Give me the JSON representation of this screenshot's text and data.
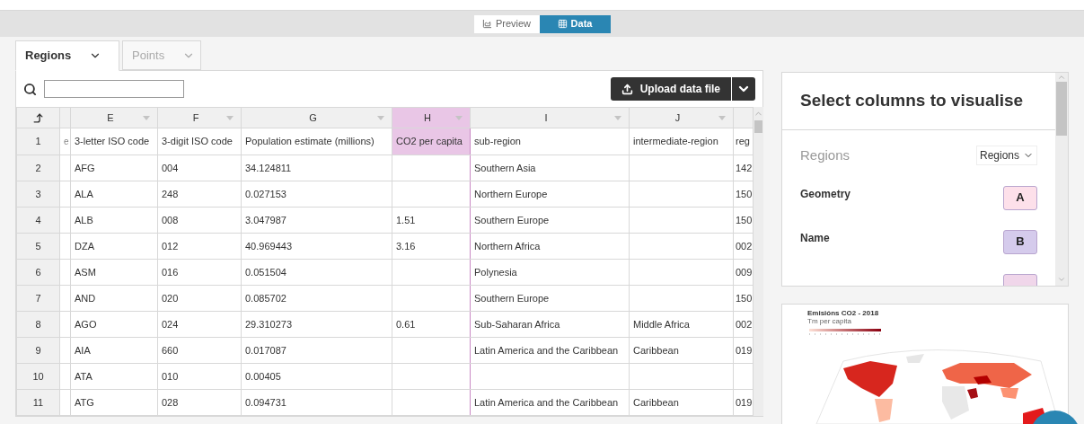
{
  "view_toggle": [
    {
      "label": "Preview",
      "kind": "chart",
      "selected": false
    },
    {
      "label": "Data",
      "kind": "table",
      "selected": true
    }
  ],
  "sheet_tabs": [
    {
      "label": "Regions",
      "selected": true
    },
    {
      "label": "Points",
      "selected": false
    }
  ],
  "upload_button": {
    "label": "Upload data file"
  },
  "table": {
    "columns": [
      {
        "header": "e",
        "highlighted": false
      },
      {
        "letter": "E",
        "header": "3-letter ISO code",
        "highlighted": false
      },
      {
        "letter": "F",
        "header": "3-digit ISO code",
        "highlighted": false
      },
      {
        "letter": "G",
        "header": "Population estimate (millions)",
        "highlighted": false
      },
      {
        "letter": "H",
        "header": "CO2 per capita",
        "highlighted": true
      },
      {
        "letter": "I",
        "header": "sub-region",
        "highlighted": false
      },
      {
        "letter": "J",
        "header": "intermediate-region",
        "highlighted": false
      },
      {
        "header": "reg",
        "highlighted": false
      }
    ],
    "header_row_number": "1",
    "rows": [
      {
        "number": "2",
        "cells": [
          "",
          "AFG",
          "004",
          "34.124811",
          "",
          "Southern Asia",
          "",
          "142"
        ]
      },
      {
        "number": "3",
        "cells": [
          "",
          "ALA",
          "248",
          "0.027153",
          "",
          "Northern Europe",
          "",
          "150"
        ]
      },
      {
        "number": "4",
        "cells": [
          "",
          "ALB",
          "008",
          "3.047987",
          "1.51",
          "Southern Europe",
          "",
          "150"
        ]
      },
      {
        "number": "5",
        "cells": [
          "",
          "DZA",
          "012",
          "40.969443",
          "3.16",
          "Northern Africa",
          "",
          "002"
        ]
      },
      {
        "number": "6",
        "cells": [
          "",
          "ASM",
          "016",
          "0.051504",
          "",
          "Polynesia",
          "",
          "009"
        ]
      },
      {
        "number": "7",
        "cells": [
          "",
          "AND",
          "020",
          "0.085702",
          "",
          "Southern Europe",
          "",
          "150"
        ]
      },
      {
        "number": "8",
        "cells": [
          "",
          "AGO",
          "024",
          "29.310273",
          "0.61",
          "Sub-Saharan Africa",
          "Middle Africa",
          "002"
        ]
      },
      {
        "number": "9",
        "cells": [
          "",
          "AIA",
          "660",
          "0.017087",
          "",
          "Latin America and the Caribbean",
          "Caribbean",
          "019"
        ]
      },
      {
        "number": "10",
        "cells": [
          "",
          "ATA",
          "010",
          "0.00405",
          "",
          "",
          "",
          ""
        ]
      },
      {
        "number": "11",
        "cells": [
          "",
          "ATG",
          "028",
          "0.094731",
          "",
          "Latin America and the Caribbean",
          "Caribbean",
          "019"
        ]
      }
    ]
  },
  "columns_panel": {
    "title": "Select columns to visualise",
    "section": "Regions",
    "sheet_select": "Regions",
    "bindings": [
      {
        "label": "Geometry",
        "badge": "A",
        "color": "#fde0ea"
      },
      {
        "label": "Name",
        "badge": "B",
        "color": "#d5cbec"
      },
      {
        "color": "#f0d6ea"
      }
    ]
  },
  "map_preview": {
    "title": "Emisións CO2 - 2018",
    "subtitle": "Tm per capita"
  }
}
